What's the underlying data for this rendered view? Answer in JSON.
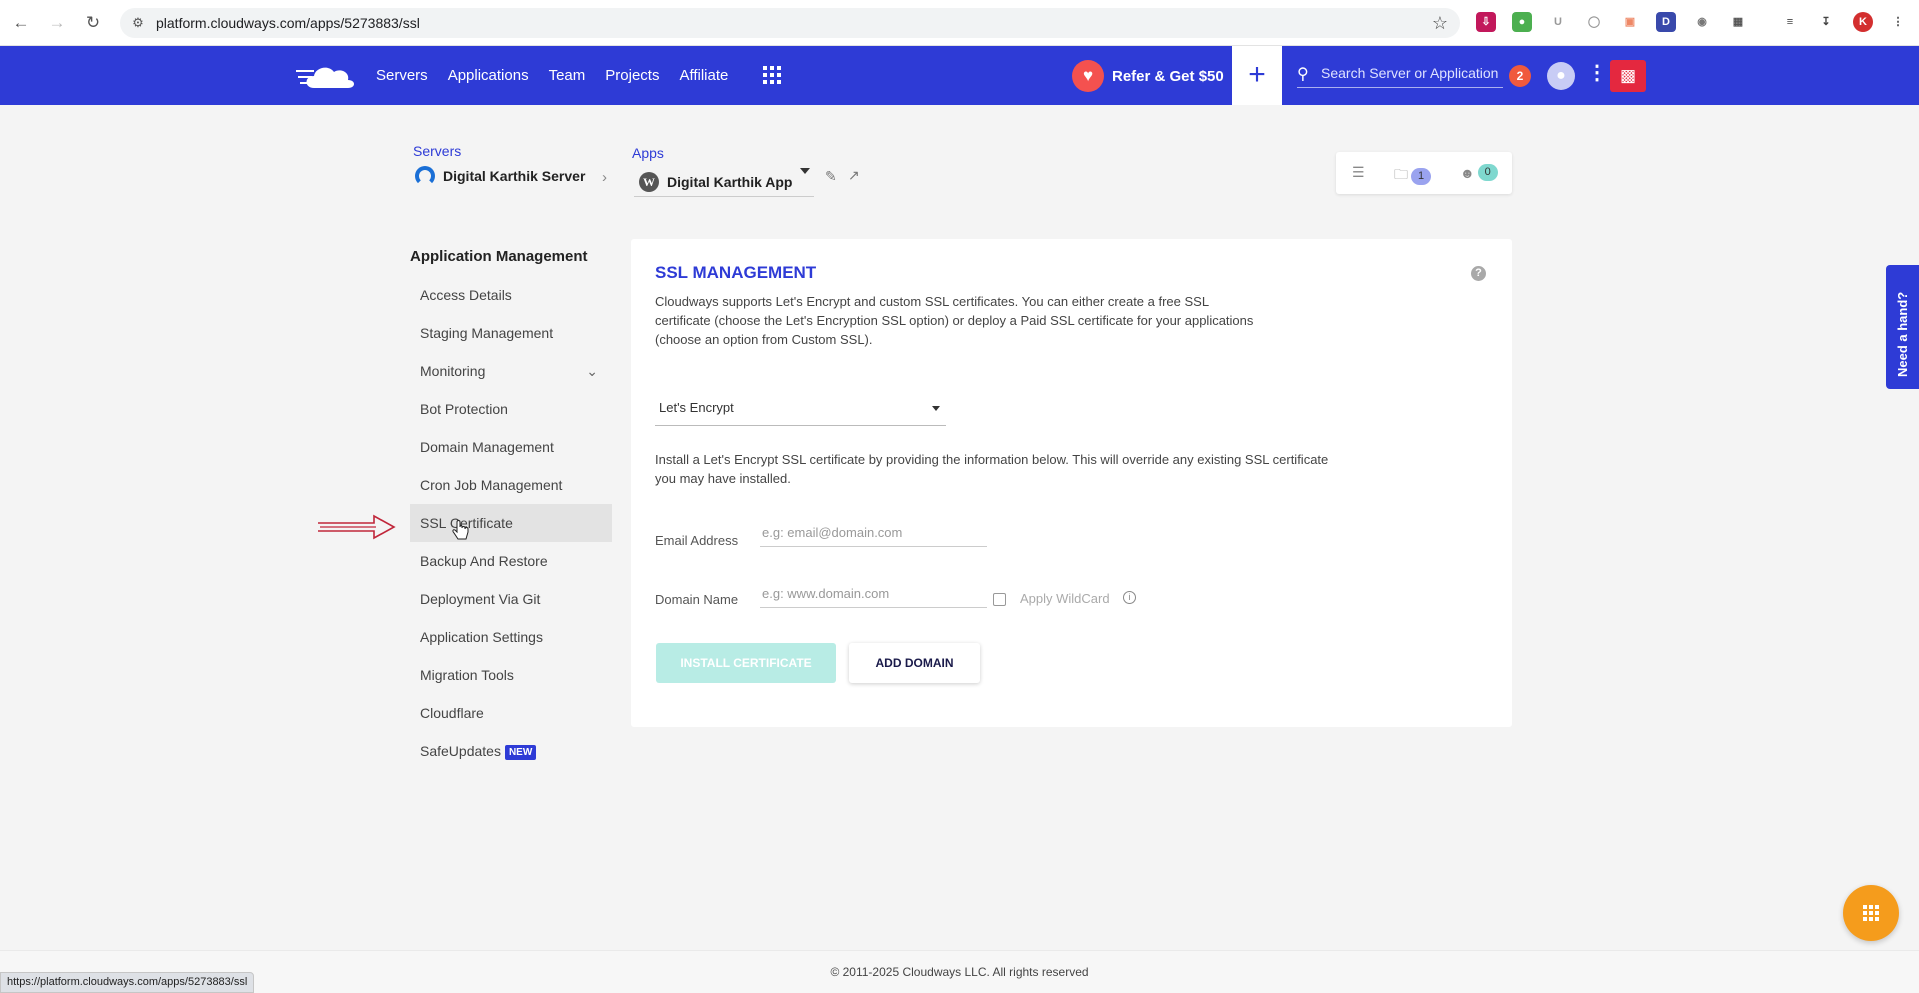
{
  "browser": {
    "url": "platform.cloudways.com/apps/5273883/ssl",
    "status_url": "https://platform.cloudways.com/apps/5273883/ssl",
    "profile_initial": "K"
  },
  "header": {
    "nav": [
      "Servers",
      "Applications",
      "Team",
      "Projects",
      "Affiliate"
    ],
    "refer_label": "Refer & Get $50",
    "search_placeholder": "Search Server or Application",
    "notification_count": "2",
    "brand_color": "#2e3bd6"
  },
  "breadcrumb": {
    "servers_label": "Servers",
    "server_name": "Digital Karthik Server",
    "apps_label": "Apps",
    "app_name": "Digital Karthik App"
  },
  "stats": {
    "folders_count": "1",
    "members_count": "0"
  },
  "sidebar": {
    "heading": "Application Management",
    "items": [
      {
        "label": "Access Details"
      },
      {
        "label": "Staging Management"
      },
      {
        "label": "Monitoring"
      },
      {
        "label": "Bot Protection"
      },
      {
        "label": "Domain Management"
      },
      {
        "label": "Cron Job Management"
      },
      {
        "label": "SSL Certificate"
      },
      {
        "label": "Backup And Restore"
      },
      {
        "label": "Deployment Via Git"
      },
      {
        "label": "Application Settings"
      },
      {
        "label": "Migration Tools"
      },
      {
        "label": "Cloudflare"
      },
      {
        "label": "SafeUpdates"
      }
    ],
    "new_badge": "NEW",
    "active_item": "SSL Certificate"
  },
  "ssl": {
    "title": "SSL MANAGEMENT",
    "description": "Cloudways supports Let's Encrypt and custom SSL certificates. You can either create a free SSL certificate (choose the Let's Encryption SSL option) or deploy a Paid SSL certificate for your applications (choose an option from Custom SSL).",
    "provider_selected": "Let's Encrypt",
    "install_description": "Install a Let's Encrypt SSL certificate by providing the information below. This will override any existing SSL certificate you may have installed.",
    "email_label": "Email Address",
    "email_placeholder": "e.g: email@domain.com",
    "domain_label": "Domain Name",
    "domain_placeholder": "e.g: www.domain.com",
    "wildcard_label": "Apply WildCard",
    "install_button": "INSTALL CERTIFICATE",
    "add_domain_button": "ADD DOMAIN"
  },
  "help_tab": "Need a hand?",
  "footer": "© 2011-2025 Cloudways LLC. All rights reserved"
}
